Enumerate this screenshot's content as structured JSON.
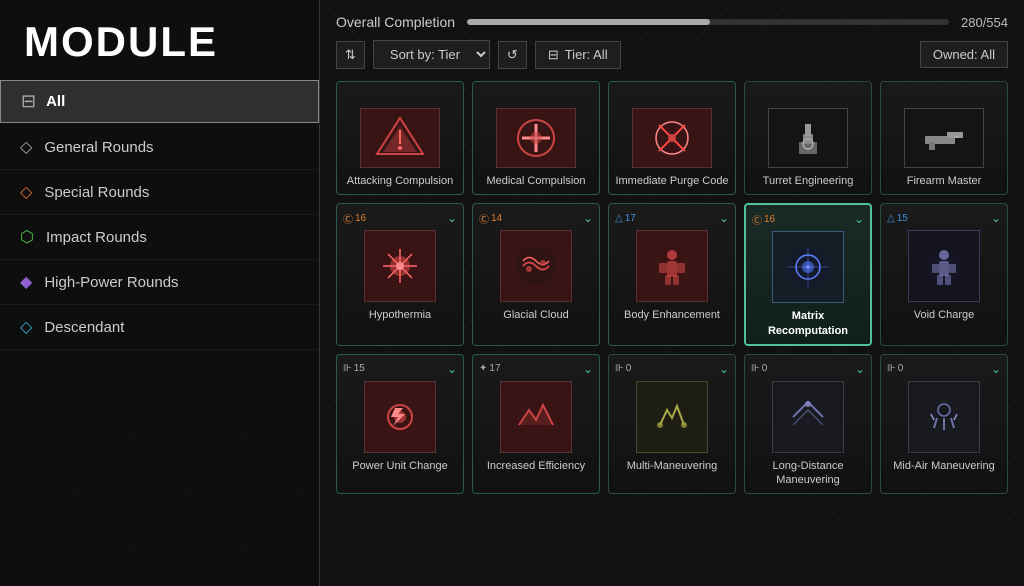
{
  "page": {
    "title": "Module"
  },
  "sidebar": {
    "all_label": "All",
    "items": [
      {
        "id": "general-rounds",
        "label": "General Rounds",
        "icon_type": "diamond",
        "icon_color": "#aaa"
      },
      {
        "id": "special-rounds",
        "label": "Special Rounds",
        "icon_type": "diamond-orange",
        "icon_color": "#e07030"
      },
      {
        "id": "impact-rounds",
        "label": "Impact Rounds",
        "icon_type": "diamond-green",
        "icon_color": "#50c050"
      },
      {
        "id": "high-power-rounds",
        "label": "High-Power Rounds",
        "icon_type": "diamond-purple",
        "icon_color": "#9060d0"
      },
      {
        "id": "descendant",
        "label": "Descendant",
        "icon_type": "diamond-teal",
        "icon_color": "#30b0c0"
      }
    ]
  },
  "completion": {
    "label": "Overall Completion",
    "current": 280,
    "total": 554,
    "display": "280/554",
    "percent": 50.5
  },
  "filters": {
    "sort_label": "Sort by: Tier",
    "tier_label": "Tier: All",
    "owned_label": "Owned: All"
  },
  "modules": {
    "row1": [
      {
        "id": "attacking-compulsion",
        "name": "Attacking Compulsion",
        "tier_type": "",
        "tier_value": "",
        "has_bookmark": false,
        "icon_symbol": "⚡",
        "bg": "red"
      },
      {
        "id": "medical-compulsion",
        "name": "Medical Compulsion",
        "tier_type": "",
        "tier_value": "",
        "has_bookmark": false,
        "icon_symbol": "✦",
        "bg": "red"
      },
      {
        "id": "immediate-purge-code",
        "name": "Immediate Purge Code",
        "tier_type": "",
        "tier_value": "",
        "has_bookmark": false,
        "icon_symbol": "⊕",
        "bg": "red"
      },
      {
        "id": "turret-engineering",
        "name": "Turret Engineering",
        "tier_type": "",
        "tier_value": "",
        "has_bookmark": false,
        "icon_symbol": "⊗",
        "bg": "dark"
      },
      {
        "id": "firearm-master",
        "name": "Firearm Master",
        "tier_type": "",
        "tier_value": "",
        "has_bookmark": false,
        "icon_symbol": "◈",
        "bg": "dark"
      }
    ],
    "row2": [
      {
        "id": "hypothermia",
        "name": "Hypothermia",
        "tier_type": "circle",
        "tier_value": "16",
        "has_bookmark": true,
        "icon_symbol": "❄",
        "bg": "red"
      },
      {
        "id": "glacial-cloud",
        "name": "Glacial Cloud",
        "tier_type": "circle",
        "tier_value": "14",
        "has_bookmark": true,
        "icon_symbol": "🌀",
        "bg": "red"
      },
      {
        "id": "body-enhancement",
        "name": "Body Enhancement",
        "tier_type": "triangle",
        "tier_value": "17",
        "has_bookmark": true,
        "icon_symbol": "⬆",
        "bg": "red"
      },
      {
        "id": "matrix-recomputation",
        "name": "Matrix Recomputation",
        "tier_type": "circle",
        "tier_value": "16",
        "has_bookmark": true,
        "icon_symbol": "◉",
        "bg": "highlighted"
      },
      {
        "id": "void-charge",
        "name": "Void Charge",
        "tier_type": "triangle",
        "tier_value": "15",
        "has_bookmark": true,
        "icon_symbol": "👤",
        "bg": "dark"
      }
    ],
    "row3": [
      {
        "id": "power-unit-change",
        "name": "Power Unit Change",
        "tier_type": "triple",
        "tier_value": "15",
        "has_bookmark": true,
        "icon_symbol": "⚙",
        "bg": "red"
      },
      {
        "id": "increased-efficiency",
        "name": "Increased Efficiency",
        "tier_type": "slash",
        "tier_value": "17",
        "has_bookmark": true,
        "icon_symbol": "⚡",
        "bg": "red"
      },
      {
        "id": "multi-maneuvering",
        "name": "Multi-Maneuvering",
        "tier_type": "triple",
        "tier_value": "0",
        "has_bookmark": true,
        "icon_symbol": "✦",
        "bg": "dark"
      },
      {
        "id": "long-distance-maneuvering",
        "name": "Long-Distance Maneuvering",
        "tier_type": "triple",
        "tier_value": "0",
        "has_bookmark": true,
        "icon_symbol": "⊕",
        "bg": "dark"
      },
      {
        "id": "mid-air-maneuvering",
        "name": "Mid-Air Maneuvering",
        "tier_type": "triple",
        "tier_value": "0",
        "has_bookmark": true,
        "icon_symbol": "⊗",
        "bg": "dark"
      }
    ]
  }
}
